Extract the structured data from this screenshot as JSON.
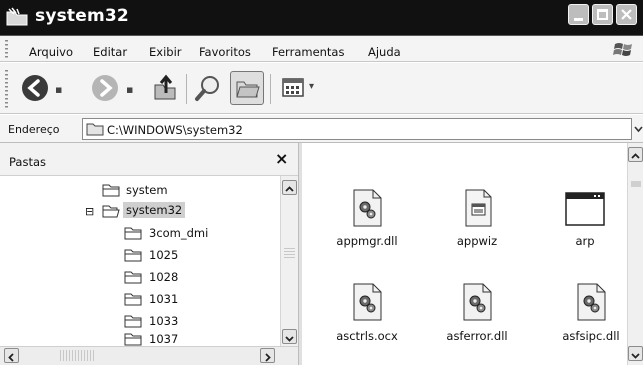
{
  "window": {
    "title": "system32"
  },
  "menu": {
    "items": [
      "Arquivo",
      "Editar",
      "Exibir",
      "Favoritos",
      "Ferramentas",
      "Ajuda"
    ]
  },
  "toolbar": {
    "buttons": [
      "back-icon",
      "forward-icon",
      "up-folder-icon",
      "search-icon",
      "folders-icon",
      "views-icon"
    ]
  },
  "address": {
    "label": "Endereço",
    "path": "C:\\WINDOWS\\system32"
  },
  "folders_pane": {
    "title": "Pastas",
    "close_glyph": "×",
    "tree": [
      {
        "label": "system",
        "expander": ""
      },
      {
        "label": "system32",
        "expander": "⊟",
        "selected": true
      },
      {
        "label": "3com_dmi",
        "expander": ""
      },
      {
        "label": "1025",
        "expander": ""
      },
      {
        "label": "1028",
        "expander": ""
      },
      {
        "label": "1031",
        "expander": ""
      },
      {
        "label": "1033",
        "expander": ""
      },
      {
        "label": "1037",
        "expander": ""
      }
    ]
  },
  "files": [
    {
      "name": "appmgr.dll",
      "icon": "dll-gear-icon"
    },
    {
      "name": "appwiz",
      "icon": "control-panel-applet-icon"
    },
    {
      "name": "arp",
      "icon": "window-icon"
    },
    {
      "name": "asctrls.ocx",
      "icon": "dll-gear-icon"
    },
    {
      "name": "asferror.dll",
      "icon": "dll-gear-icon"
    },
    {
      "name": "asfsipc.dll",
      "icon": "dll-gear-icon"
    }
  ]
}
